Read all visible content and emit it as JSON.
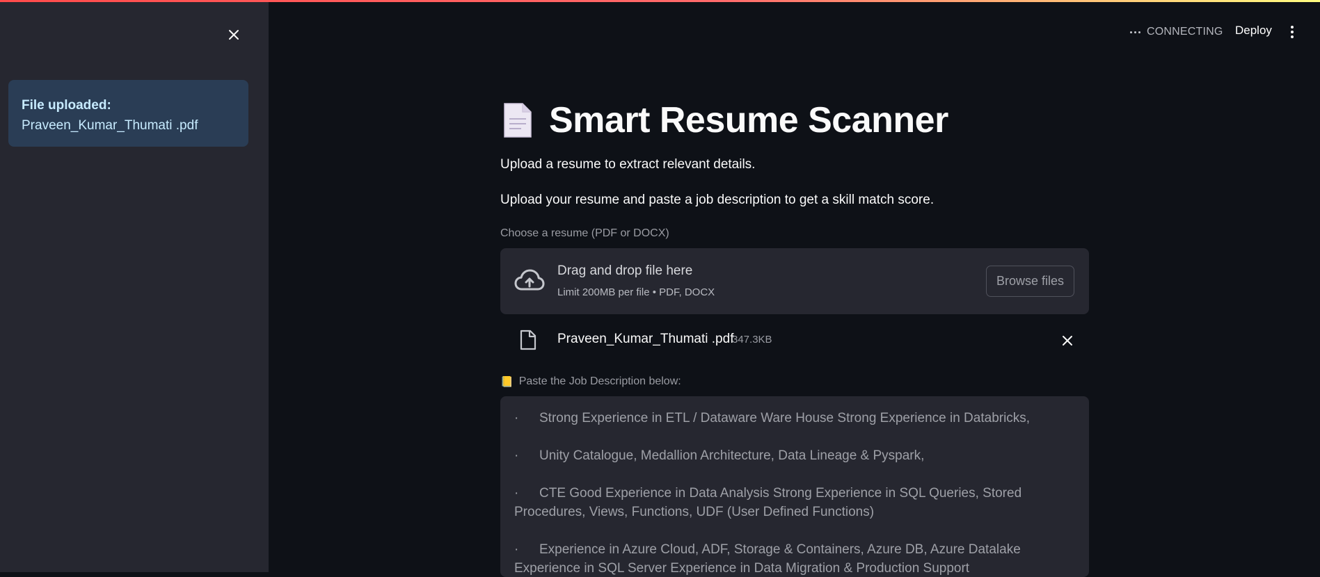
{
  "sidebar": {
    "alert_title": "File uploaded:",
    "alert_filename": "Praveen_Kumar_Thumati .pdf"
  },
  "header": {
    "status": "CONNECTING",
    "deploy_label": "Deploy"
  },
  "main": {
    "title_emoji": "📄",
    "title": "Smart Resume Scanner",
    "subtitle1": "Upload a resume to extract relevant details.",
    "subtitle2": "Upload your resume and paste a job description to get a skill match score.",
    "uploader": {
      "label": "Choose a resume (PDF or DOCX)",
      "drop_title": "Drag and drop file here",
      "drop_sub": "Limit 200MB per file • PDF, DOCX",
      "browse_label": "Browse files"
    },
    "uploaded_file": {
      "name": "Praveen_Kumar_Thumati .pdf",
      "size": "347.3KB"
    },
    "jd": {
      "label_icon": "📒",
      "label": "Paste the Job Description below:",
      "lines": [
        "Strong Experience in ETL / Dataware Ware House Strong Experience in Databricks,",
        "Unity Catalogue, Medallion Architecture, Data Lineage & Pyspark,",
        "CTE Good Experience in Data Analysis Strong Experience in SQL Queries, Stored Procedures, Views, Functions, UDF (User Defined Functions)",
        "Experience in Azure Cloud, ADF, Storage & Containers, Azure DB, Azure Datalake Experience in SQL Server Experience in Data Migration & Production Support"
      ],
      "bullet": "·"
    }
  },
  "colors": {
    "background": "#0e1117",
    "sidebar": "#262730",
    "alert_bg": "#2a3d55",
    "alert_text": "#c7ebff",
    "accent_line_start": "#ff4b4b",
    "accent_line_end": "#fffd80"
  }
}
